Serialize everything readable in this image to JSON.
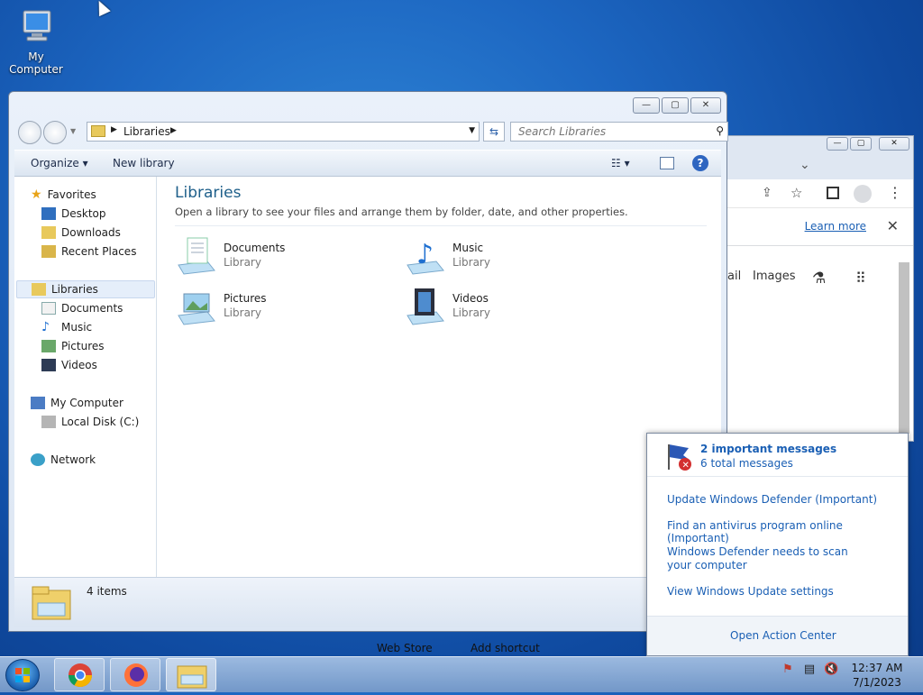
{
  "desktop": {
    "icon_label": "My Computer"
  },
  "explorer": {
    "address": "Libraries",
    "search_placeholder": "Search Libraries",
    "organize": "Organize",
    "new_library": "New library",
    "nav": {
      "favorites": "Favorites",
      "desktop": "Desktop",
      "downloads": "Downloads",
      "recent_places": "Recent Places",
      "libraries": "Libraries",
      "documents": "Documents",
      "music": "Music",
      "pictures": "Pictures",
      "videos": "Videos",
      "my_computer": "My Computer",
      "local_disk": "Local Disk (C:)",
      "network": "Network"
    },
    "title": "Libraries",
    "subtitle": "Open a library to see your files and arrange them by folder, date, and other properties.",
    "tiles": [
      {
        "name": "Documents",
        "sub": "Library"
      },
      {
        "name": "Music",
        "sub": "Library"
      },
      {
        "name": "Pictures",
        "sub": "Library"
      },
      {
        "name": "Videos",
        "sub": "Library"
      }
    ],
    "status_count": "4 items"
  },
  "chrome": {
    "learn_more": "Learn more",
    "nav_mail": "ail",
    "nav_images": "Images",
    "bottom_web_store": "Web Store",
    "bottom_add_shortcut": "Add shortcut"
  },
  "action_center": {
    "important": "2 important messages",
    "total": "6 total messages",
    "links": [
      "Update Windows Defender (Important)",
      "Find an antivirus program online (Important)",
      "Windows Defender needs to scan your computer",
      "View Windows Update settings"
    ],
    "open": "Open Action Center"
  },
  "taskbar": {
    "time": "12:37 AM",
    "date": "7/1/2023"
  }
}
